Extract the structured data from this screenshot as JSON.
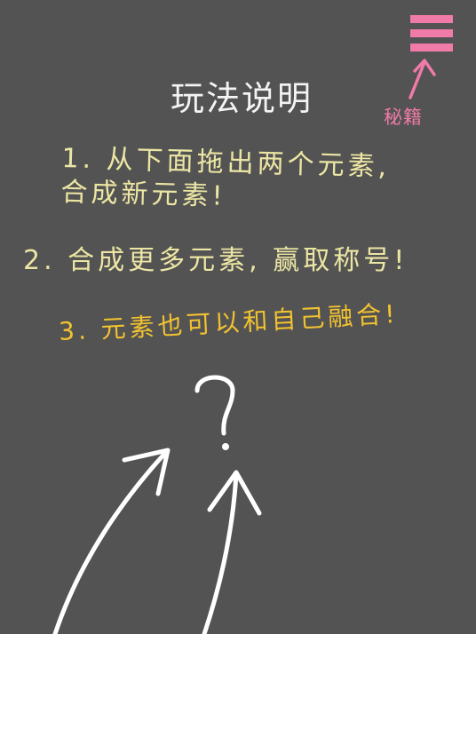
{
  "header": {
    "title": "玩法说明"
  },
  "menu": {
    "label": "秘籍",
    "icon": "hamburger-menu-icon",
    "color": "#f07aa8"
  },
  "instructions": {
    "item1_line1": "1. 从下面拖出两个元素,",
    "item1_line2": "合成新元素!",
    "item2": "2. 合成更多元素, 赢取称号!",
    "item3": "3. 元素也可以和自己融合!"
  },
  "doodle": {
    "question_mark": "?",
    "icon": "two-arrows-question-icon"
  },
  "colors": {
    "board": "#535353",
    "title": "#f4f4f4",
    "instruction_text": "#ece6a4",
    "highlight_text": "#f2c230",
    "accent": "#f07aa8"
  }
}
